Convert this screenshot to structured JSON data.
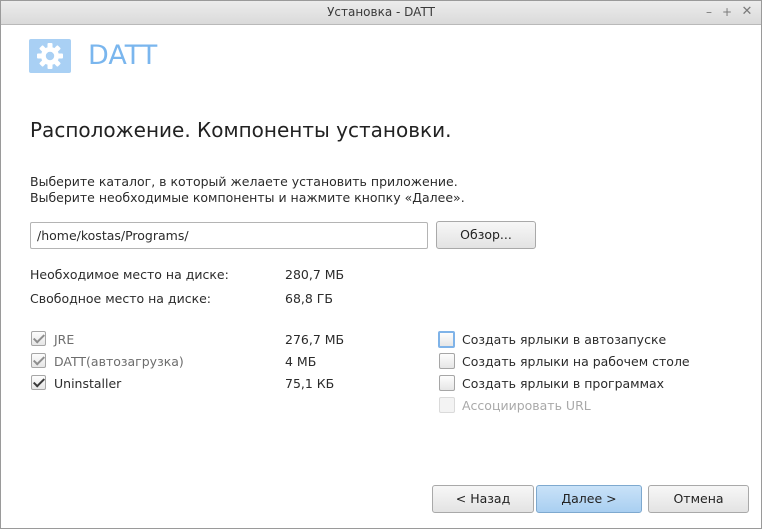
{
  "window": {
    "title": "Установка - DATT",
    "min": "–",
    "max": "+",
    "close": "✕"
  },
  "app": {
    "name": "DATT",
    "logo_icon": "gear-icon"
  },
  "page": {
    "heading": "Расположение. Компоненты установки.",
    "desc_line1": "Выберите каталог, в который желаете установить приложение.",
    "desc_line2": "Выберите необходимые компоненты и нажмите кнопку «Далее»."
  },
  "path": {
    "value": "/home/kostas/Programs/",
    "browse_label": "Обзор..."
  },
  "space": {
    "required_label": "Необходимое место на диске:",
    "required_value": "280,7 МБ",
    "free_label": "Свободное место на диске:",
    "free_value": "68,8 ГБ"
  },
  "components": [
    {
      "label": "JRE",
      "size": "276,7 МБ",
      "checked": true,
      "locked": true
    },
    {
      "label": "DATT(автозагрузка)",
      "size": "4 МБ",
      "checked": true,
      "locked": true
    },
    {
      "label": "Uninstaller",
      "size": "75,1 КБ",
      "checked": true,
      "locked": false
    }
  ],
  "options": [
    {
      "label": "Создать ярлыки в автозапуске",
      "checked": false,
      "enabled": true,
      "focused": true
    },
    {
      "label": "Создать ярлыки на рабочем столе",
      "checked": false,
      "enabled": true
    },
    {
      "label": "Создать ярлыки в программах",
      "checked": false,
      "enabled": true
    },
    {
      "label": "Ассоциировать URL",
      "checked": false,
      "enabled": false
    }
  ],
  "buttons": {
    "back": "< Назад",
    "next": "Далее >",
    "cancel": "Отмена"
  },
  "colors": {
    "accent": "#7ab6ee",
    "logo_bg": "#a9d0f4",
    "next_button": "#b9d9f5"
  }
}
